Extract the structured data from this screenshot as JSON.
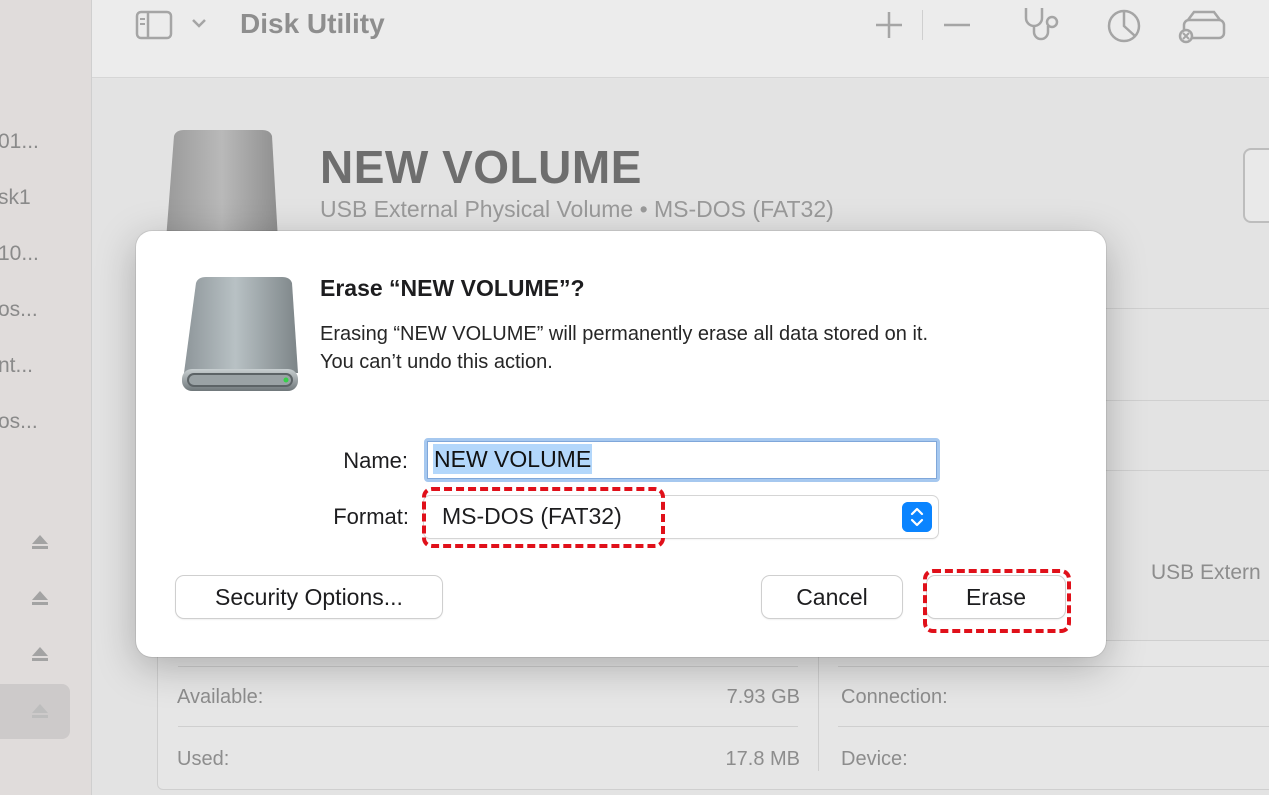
{
  "app": {
    "title": "Disk Utility"
  },
  "sidebar": {
    "items": [
      "01...",
      "sk1",
      "10...",
      "os...",
      "nt...",
      "os..."
    ]
  },
  "volume": {
    "name": "NEW VOLUME",
    "subtitle": "USB External Physical Volume • MS-DOS (FAT32)"
  },
  "info": {
    "available_label": "Available:",
    "available_value": "7.93 GB",
    "used_label": "Used:",
    "used_value": "17.8 MB",
    "connection_label": "Connection:",
    "device_label": "Device:",
    "type_value_truncated": "USB Extern"
  },
  "dialog": {
    "title": "Erase “NEW VOLUME”?",
    "message_line1": "Erasing “NEW VOLUME” will permanently erase all data stored on it.",
    "message_line2": "You can’t undo this action.",
    "name_label": "Name:",
    "name_value": "NEW VOLUME",
    "format_label": "Format:",
    "format_value": "MS-DOS (FAT32)",
    "security_button": "Security Options...",
    "cancel_button": "Cancel",
    "erase_button": "Erase"
  },
  "annotations": {
    "highlight_color": "#e0101a"
  },
  "colors": {
    "accent": "#0a84ff",
    "selection": "#b3d7fb"
  }
}
